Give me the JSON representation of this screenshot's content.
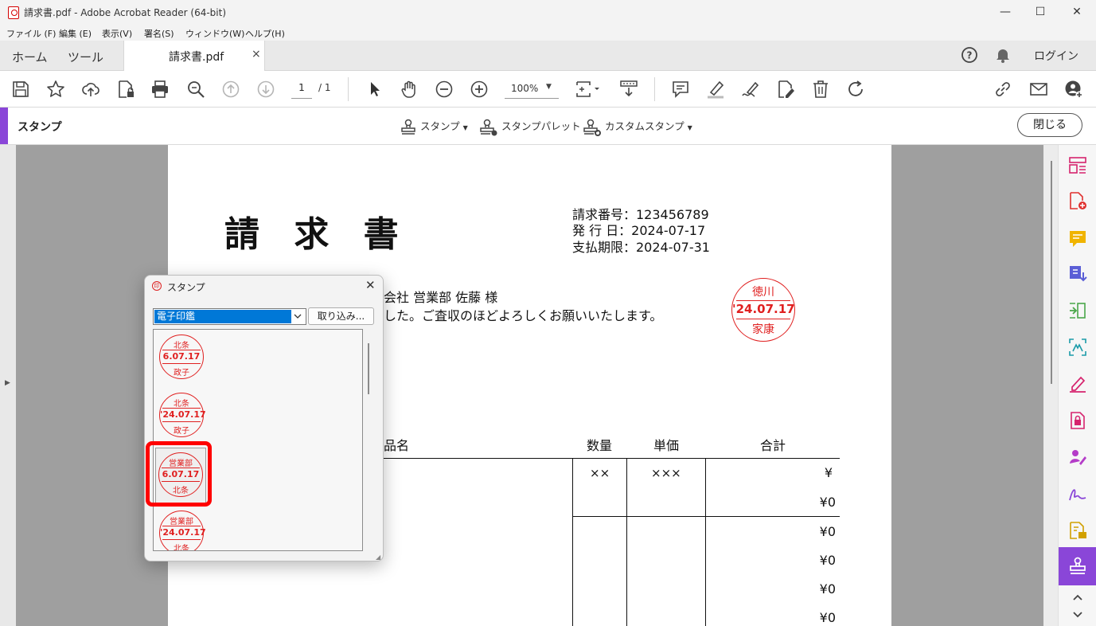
{
  "window": {
    "title": "請求書.pdf - Adobe Acrobat Reader (64-bit)",
    "controls": {
      "minimize": "—",
      "maximize": "☐",
      "close": "✕"
    }
  },
  "menu": [
    "ファイル (F)",
    "編集 (E)",
    "表示(V)",
    "署名(S)",
    "ウィンドウ(W)",
    "ヘルプ(H)"
  ],
  "tabs": {
    "home": "ホーム",
    "tools": "ツール",
    "document": "請求書.pdf",
    "document_close": "×",
    "login": "ログイン"
  },
  "toolbar": {
    "page_current": "1",
    "page_total": "/ 1",
    "zoom": "100%"
  },
  "stamp_bar": {
    "label": "スタンプ",
    "stamp": "スタンプ",
    "palette": "スタンプパレット",
    "custom": "カスタムスタンプ",
    "close": "閉じる"
  },
  "invoice": {
    "title": "請 求 書",
    "number_label": "請求番号：123456789",
    "issue_label": "発 行 日：2024-07-17",
    "due_label": "支払期限：2024-07-31",
    "recipient_fragment": "会社 営業部 佐藤 様",
    "message_fragment": "した。ご査収のほどよろしくお願いいたします。",
    "seal": {
      "top": "徳川",
      "date": "'24.07.17",
      "bottom": "家康"
    },
    "table": {
      "headers": [
        "品名",
        "数量",
        "単価",
        "合計"
      ],
      "qty": "××",
      "price": "×××",
      "totals": [
        "¥",
        "¥0",
        "¥0",
        "¥0",
        "¥0",
        "¥0"
      ]
    }
  },
  "stamp_dialog": {
    "title": "スタンプ",
    "icon_text": "印",
    "close": "✕",
    "category": "電子印鑑",
    "import": "取り込み...",
    "stamps": [
      {
        "top": "北条",
        "date": "6.07.17",
        "bottom": "政子"
      },
      {
        "top": "北条",
        "date": "'24.07.17",
        "bottom": "政子"
      },
      {
        "top": "営業部",
        "date": "6.07.17",
        "bottom": "北条"
      },
      {
        "top": "営業部",
        "date": "'24.07.17",
        "bottom": "北条"
      }
    ]
  },
  "colors": {
    "accent": "#8a46d8",
    "seal_red": "#e02020",
    "highlight": "#ff0000",
    "selection": "#0078d7"
  }
}
